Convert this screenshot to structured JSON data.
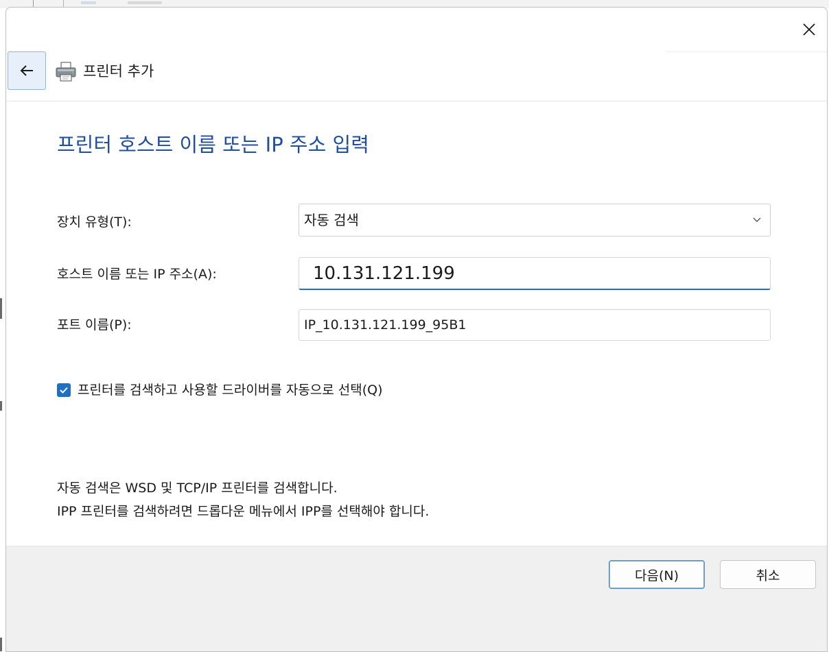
{
  "window": {
    "close_icon": "close-icon"
  },
  "nav": {
    "back_icon": "back-arrow-icon",
    "printer_icon": "printer-icon",
    "title": "프린터 추가"
  },
  "page": {
    "heading": "프린터 호스트 이름 또는 IP 주소 입력"
  },
  "form": {
    "device_type": {
      "label": "장치 유형(T):",
      "selected": "자동 검색"
    },
    "host": {
      "label": "호스트 이름 또는 IP 주소(A):",
      "value": "10.131.121.199"
    },
    "port": {
      "label": "포트 이름(P):",
      "value": "IP_10.131.121.199_95B1"
    },
    "auto_driver": {
      "label": "프린터를 검색하고 사용할 드라이버를 자동으로 선택(Q)",
      "checked": true
    }
  },
  "info": {
    "line1": "자동 검색은 WSD 및 TCP/IP 프린터를 검색합니다.",
    "line2": "IPP 프린터를 검색하려면 드롭다운 메뉴에서 IPP를 선택해야 합니다."
  },
  "footer": {
    "next_label": "다음(N)",
    "cancel_label": "취소"
  },
  "colors": {
    "accent": "#1f6fc5",
    "heading": "#1e4ea0",
    "footer_bg": "#f0f0f0"
  }
}
